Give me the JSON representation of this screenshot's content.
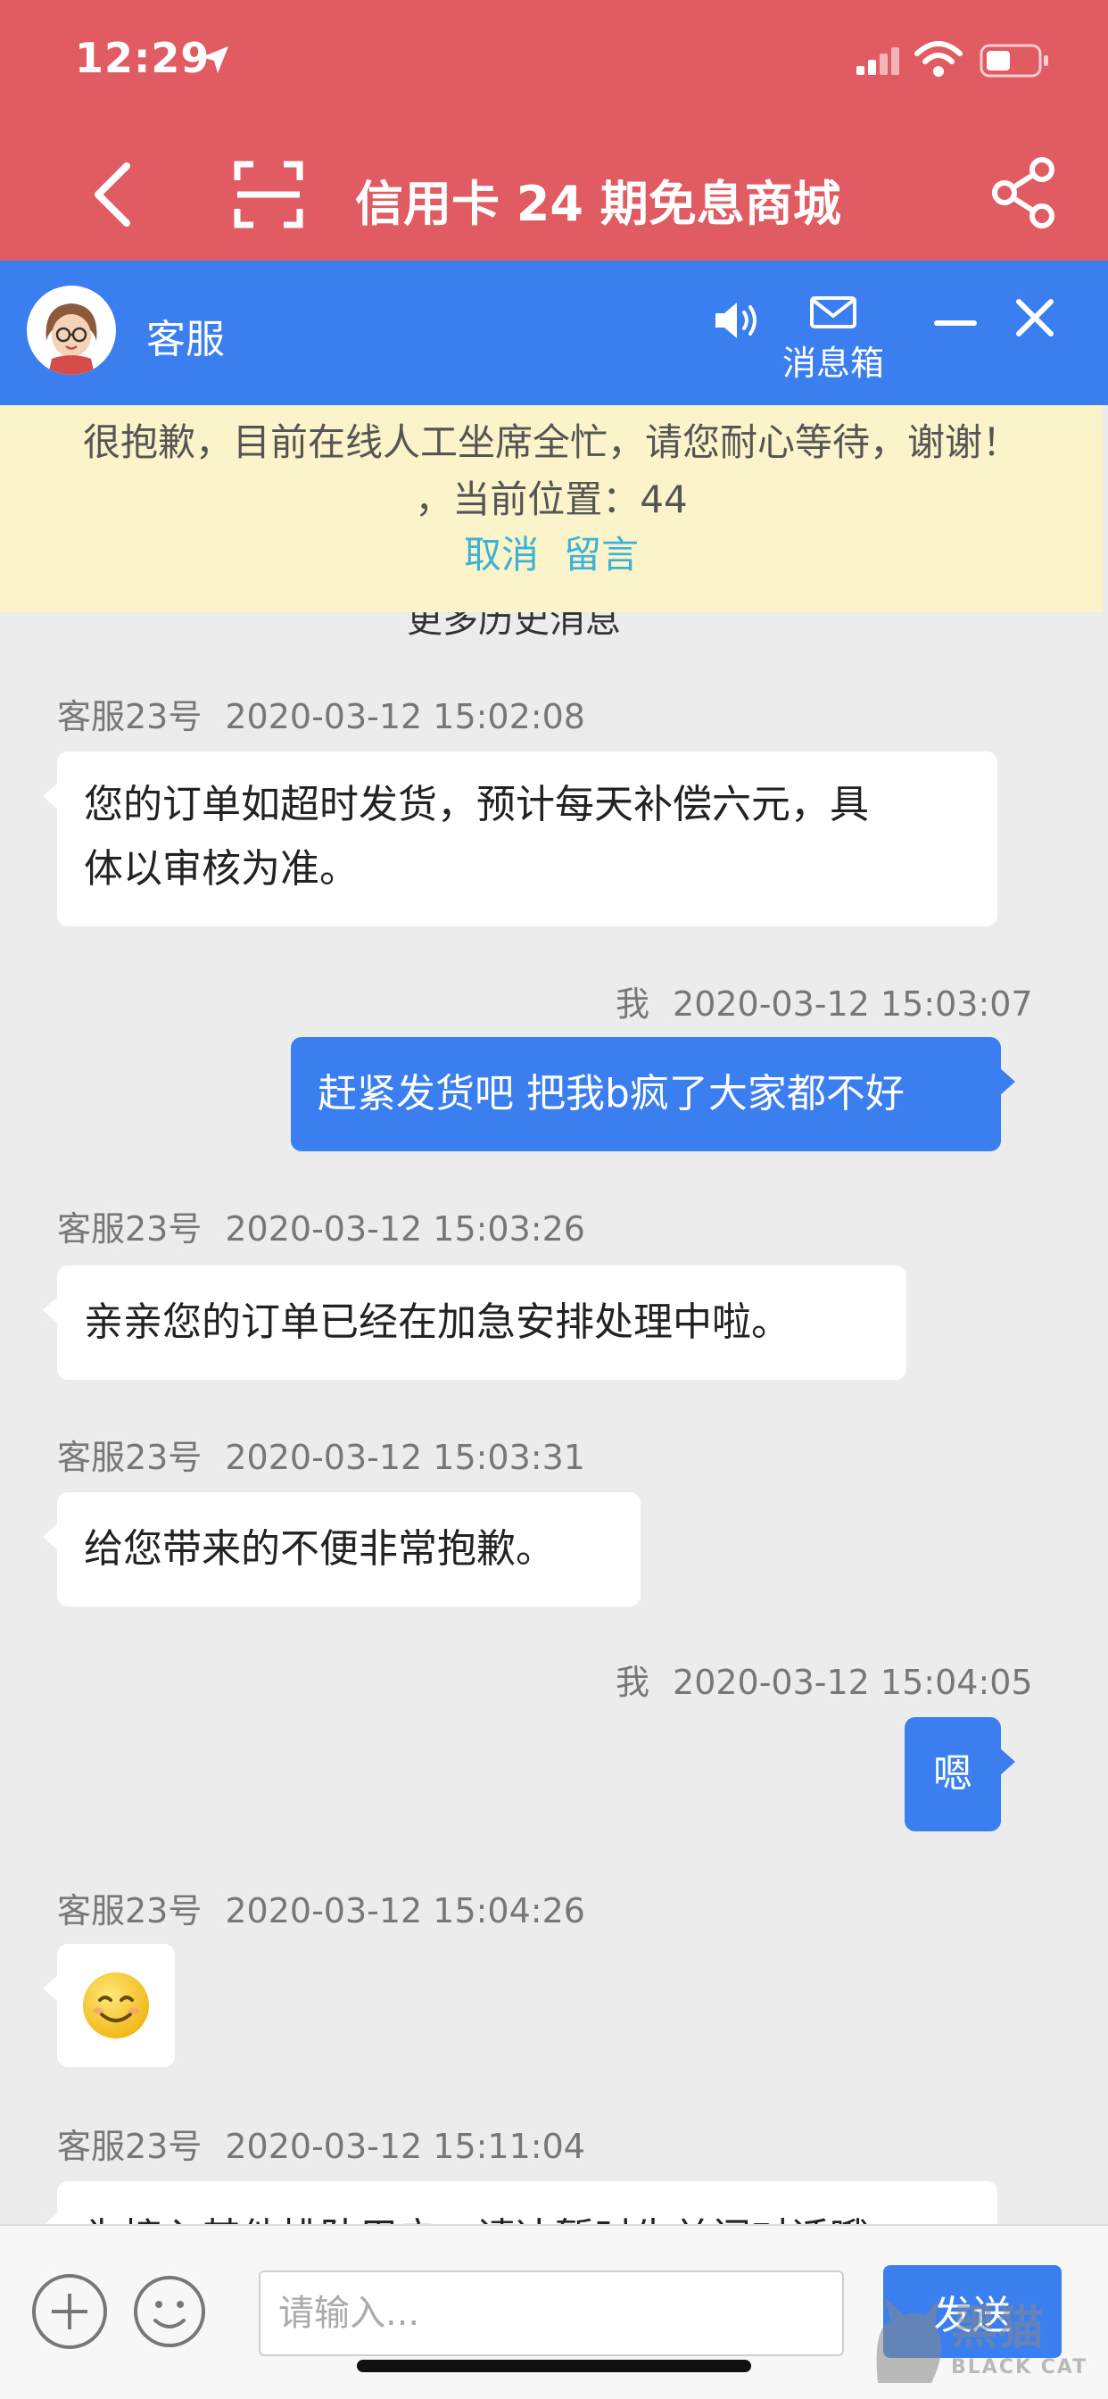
{
  "status": {
    "time": "12:29"
  },
  "nav": {
    "title": "信用卡 24 期免息商城"
  },
  "cs": {
    "name": "客服",
    "mailbox_label": "消息箱"
  },
  "notice": {
    "line1": "很抱歉，目前在线人工坐席全忙，请您耐心等待，谢谢！",
    "line2": "，当前位置：44",
    "cancel": "取消",
    "leave_msg": "留言"
  },
  "more_history": "更多历史消息",
  "messages": [
    {
      "sender": "客服23号",
      "time": "2020-03-12 15:02:08",
      "line1": "您的订单如超时发货，预计每天补偿六元，具",
      "line2": "体以审核为准。"
    },
    {
      "sender": "我",
      "time": "2020-03-12 15:03:07",
      "text": "赶紧发货吧 把我b疯了大家都不好"
    },
    {
      "sender": "客服23号",
      "time": "2020-03-12 15:03:26",
      "text": "亲亲您的订单已经在加急安排处理中啦。"
    },
    {
      "sender": "客服23号",
      "time": "2020-03-12 15:03:31",
      "text": "给您带来的不便非常抱歉。"
    },
    {
      "sender": "我",
      "time": "2020-03-12 15:04:05",
      "text": "嗯"
    },
    {
      "sender": "客服23号",
      "time": "2020-03-12 15:04:26",
      "emoji": "smiley"
    },
    {
      "sender": "客服23号",
      "time": "2020-03-12 15:11:04",
      "text": "为接入其他排队用户，请决暂时先关闭对话哦"
    }
  ],
  "input": {
    "placeholder": "请输入...",
    "send_label": "发送"
  },
  "watermark": {
    "text": "黑猫",
    "sub": "BLACK CAT"
  },
  "icons": [
    "location-arrow-icon",
    "signal-icon",
    "wifi-icon",
    "battery-icon",
    "back-icon",
    "scan-icon",
    "share-icon",
    "speaker-icon",
    "mail-icon",
    "minimize-icon",
    "close-icon",
    "plus-icon",
    "emoji-icon"
  ],
  "colors": {
    "nav_red": "#e05b62",
    "cs_blue": "#3a7ef0",
    "notice_bg": "#fbf3c9",
    "link": "#3cb2d6"
  }
}
